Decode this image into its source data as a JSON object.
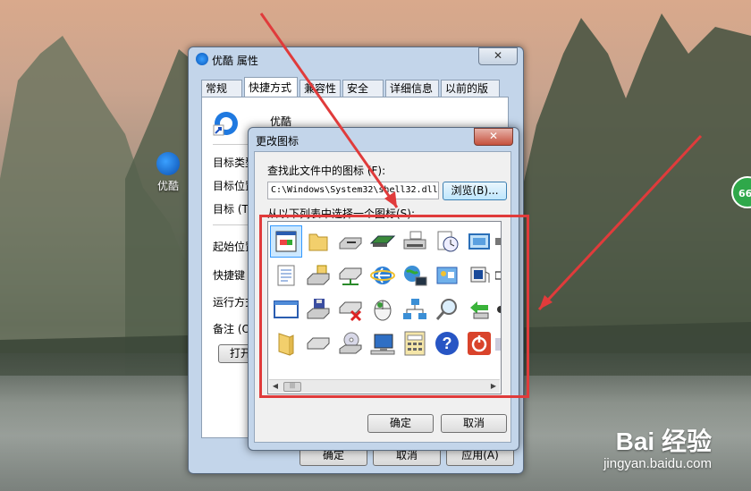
{
  "desktop": {
    "shortcut_label": "优酷",
    "right_badge": "66"
  },
  "properties_window": {
    "title": "优酷 属性",
    "close": "✕",
    "tabs": [
      "常规",
      "快捷方式",
      "兼容性",
      "安全",
      "详细信息",
      "以前的版本"
    ],
    "active_tab": "快捷方式",
    "shortcut_name": "优酷",
    "field_labels": [
      "目标类型",
      "目标位置",
      "目标(T)",
      "起始位置",
      "快捷键",
      "运行方式",
      "备注(O)"
    ],
    "field_labels_visible": [
      "目标类型",
      "目标位置",
      "目标 (T",
      "起始位置",
      "快捷键",
      "运行方式",
      "备注 (O"
    ],
    "open_button_partial": "打开",
    "bottom_buttons": [
      "确定",
      "取消",
      "应用(A)"
    ]
  },
  "change_icon_dialog": {
    "title": "更改图标",
    "close": "✕",
    "search_label": "查找此文件中的图标 (F):",
    "path_value": "C:\\Windows\\System32\\shell32.dll",
    "browse_button": "浏览(B)...",
    "list_label": "从以下列表中选择一个图标(S):",
    "ok_button": "确定",
    "cancel_button": "取消",
    "icons": [
      [
        "blank-document-icon",
        "folder-icon",
        "floppy-drive-icon",
        "memory-chip-icon",
        "printer-icon",
        "clock-document-icon",
        "network-window-icon",
        "partial-icon"
      ],
      [
        "text-document-icon",
        "disk-drive-icon",
        "network-drive-icon",
        "internet-explorer-icon",
        "network-globe-icon",
        "control-panel-icon",
        "device-icon",
        "shortcut-arrow-icon"
      ],
      [
        "window-icon",
        "save-drive-icon",
        "disconnected-drive-icon",
        "mouse-icon",
        "network-share-icon",
        "magnifier-icon",
        "green-arrow-icon",
        "partial-icon"
      ],
      [
        "folder-icon",
        "hard-drive-icon",
        "cd-drive-icon",
        "computer-icon",
        "calculator-icon",
        "help-icon",
        "power-icon",
        "partial-icon"
      ]
    ]
  },
  "watermark": {
    "logo": "Bai 经验",
    "url": "jingyan.baidu.com"
  },
  "colors": {
    "annotation_red": "#e03b3b",
    "window_frame": "#c3d5ea",
    "selection": "#cce8ff"
  }
}
